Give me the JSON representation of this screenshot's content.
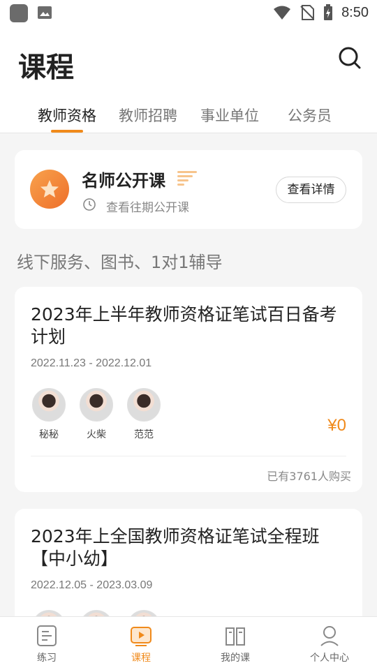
{
  "status_bar": {
    "time": "8:50"
  },
  "header": {
    "title": "课程"
  },
  "tabs": [
    {
      "label": "教师资格",
      "active": true
    },
    {
      "label": "教师招聘",
      "active": false
    },
    {
      "label": "事业单位",
      "active": false
    },
    {
      "label": "公务员",
      "active": false
    }
  ],
  "promo": {
    "title": "名师公开课",
    "subtitle": "查看往期公开课",
    "button_label": "查看详情"
  },
  "section_title": "线下服务、图书、1对1辅导",
  "courses": [
    {
      "title": "2023年上半年教师资格证笔试百日备考计划",
      "date": "2022.11.23 - 2022.12.01",
      "teachers": [
        "秘秘",
        "火柴",
        "范范"
      ],
      "price": "¥0",
      "purchased": "已有3761人购买"
    },
    {
      "title": "2023年上全国教师资格证笔试全程班【中小幼】",
      "date": "2022.12.05 - 2023.03.09"
    }
  ],
  "bottom_nav": [
    {
      "label": "练习",
      "active": false
    },
    {
      "label": "课程",
      "active": true
    },
    {
      "label": "我的课",
      "active": false
    },
    {
      "label": "个人中心",
      "active": false
    }
  ],
  "colors": {
    "accent": "#f08a1b",
    "background": "#f5f5f5"
  }
}
